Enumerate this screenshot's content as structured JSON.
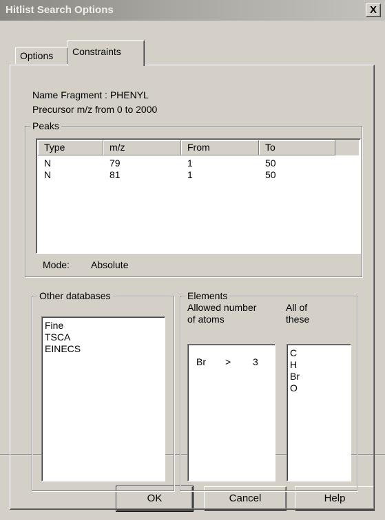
{
  "window": {
    "title": "Hitlist Search Options",
    "close_label": "X"
  },
  "tabs": [
    {
      "label": "Options",
      "selected": false
    },
    {
      "label": "Constraints",
      "selected": true
    }
  ],
  "constraints": {
    "name_fragment": "Name Fragment :  PHENYL",
    "precursor": "Precursor m/z from 0 to 2000",
    "peaks": {
      "legend": "Peaks",
      "columns": [
        "Type",
        "m/z",
        "From",
        "To"
      ],
      "rows": [
        [
          "N",
          "79",
          "1",
          "50"
        ],
        [
          "N",
          "81",
          "1",
          "50"
        ]
      ],
      "mode_label": "Mode:",
      "mode_value": "Absolute"
    },
    "other_databases": {
      "legend": "Other databases",
      "items": [
        "Fine",
        "TSCA",
        "EINECS"
      ]
    },
    "elements": {
      "legend": "Elements",
      "allowed_label_1": "Allowed number",
      "allowed_label_2": "of atoms",
      "all_of_label_1": "All of",
      "all_of_label_2": "these",
      "allowed_rows": [
        {
          "element": "Br",
          "op": ">",
          "count": "3"
        }
      ],
      "all_of_items": [
        "C",
        "H",
        "Br",
        "O"
      ]
    }
  },
  "buttons": {
    "ok": "OK",
    "cancel": "Cancel",
    "help": "Help"
  }
}
